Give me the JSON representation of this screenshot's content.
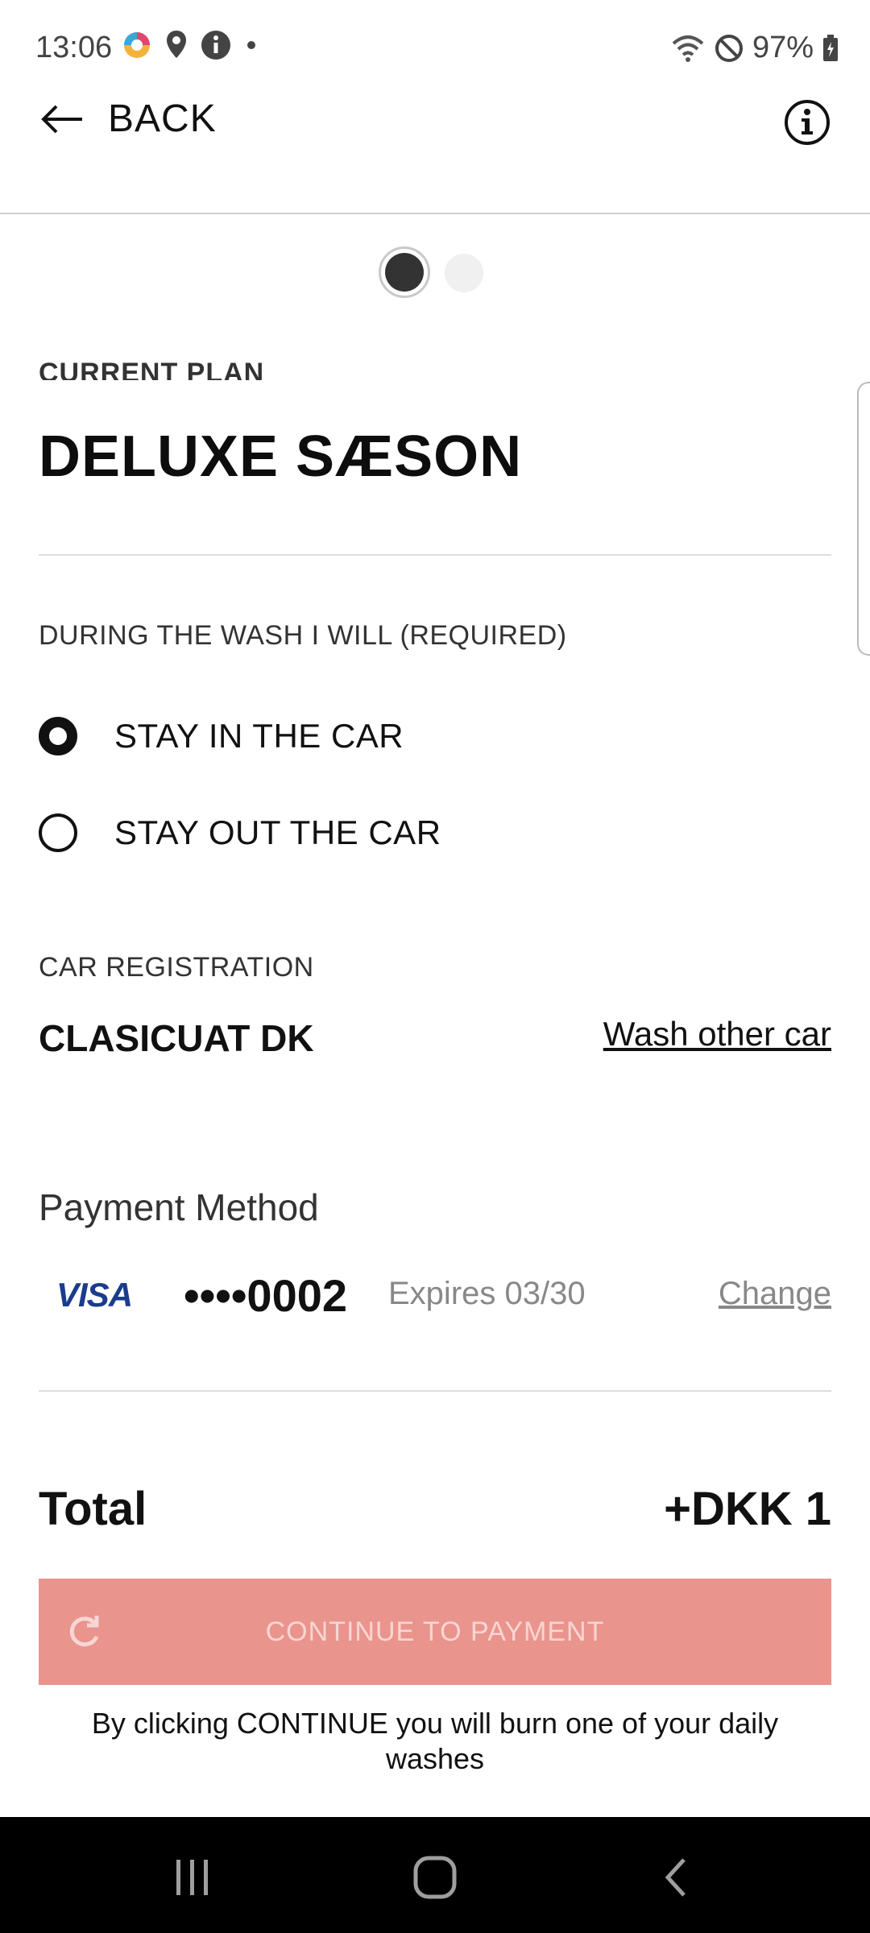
{
  "status_bar": {
    "time": "13:06",
    "battery": "97%"
  },
  "header": {
    "back_label": "BACK"
  },
  "plan": {
    "label": "CURRENT PLAN",
    "name": "DELUXE SÆSON"
  },
  "wash_option": {
    "label": "DURING THE WASH I WILL (REQUIRED)",
    "options": [
      {
        "label": "STAY IN THE CAR",
        "selected": true
      },
      {
        "label": "STAY OUT THE CAR",
        "selected": false
      }
    ]
  },
  "registration": {
    "label": "CAR REGISTRATION",
    "value": "CLASICUAT DK",
    "wash_other_label": "Wash other car"
  },
  "payment": {
    "title": "Payment Method",
    "brand": "VISA",
    "card_number": "••••0002",
    "expires": "Expires 03/30",
    "change_label": "Change"
  },
  "total": {
    "label": "Total",
    "value": "+DKK 1"
  },
  "cta": {
    "label": "CONTINUE TO PAYMENT",
    "color": "#ea948e"
  },
  "disclaimer": "By clicking CONTINUE you will burn one of your daily washes"
}
